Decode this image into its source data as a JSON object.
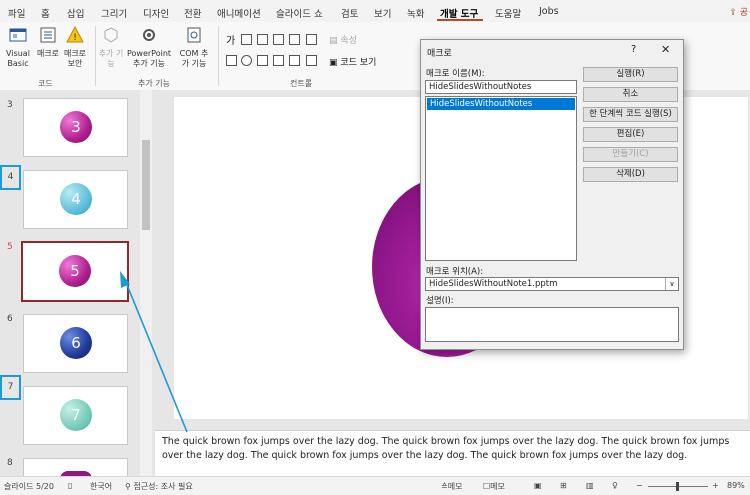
{
  "tabs": [
    "파일",
    "홈",
    "삽입",
    "그리기",
    "디자인",
    "전환",
    "애니메이션",
    "슬라이드 쇼",
    "검토",
    "보기",
    "녹화",
    "개발 도구",
    "도움말",
    "Jobs"
  ],
  "active_tab": "개발 도구",
  "share_label": "공",
  "ribbon": {
    "code": {
      "vb": "Visual Basic",
      "macro": "매크로",
      "security": "매크로 보안",
      "label": "코드"
    },
    "addins": {
      "addin": "추가 기능",
      "ppt_addin": "PowerPoint 추가 기능",
      "com_addin": "COM 추가 기능",
      "label": "추가 기능"
    },
    "controls": {
      "props": "속성",
      "view_code": "코드 보기",
      "label": "컨트롤",
      "text_glyph": "가"
    }
  },
  "slides": [
    {
      "num": "3",
      "value": "3"
    },
    {
      "num": "4",
      "value": "4",
      "hidden_mark": "4"
    },
    {
      "num": "5",
      "value": "5"
    },
    {
      "num": "6",
      "value": "6"
    },
    {
      "num": "7",
      "value": "7",
      "hidden_mark": "7"
    },
    {
      "num": "8",
      "value": ""
    }
  ],
  "notes": "The quick brown fox jumps over the lazy dog. The quick brown fox jumps over the lazy dog. The quick brown fox jumps over the lazy dog. The quick brown fox jumps over the lazy dog. The quick brown fox jumps over the lazy dog.",
  "status": {
    "slide": "슬라이드 5/20",
    "lang": "한국어",
    "access": "접근성: 조사 필요",
    "notes": "슬라이드 노트",
    "notes_btn": "메모",
    "comments_btn": "메모",
    "zoom": "89%",
    "zoom_minus": "−",
    "zoom_plus": "+"
  },
  "dialog": {
    "title": "매크로",
    "help": "?",
    "close": "✕",
    "name_label": "매크로 이름(M):",
    "name_value": "HideSlidesWithoutNotes",
    "list": [
      "HideSlidesWithoutNotes"
    ],
    "location_label": "매크로 위치(A):",
    "location_value": "HideSlidesWithoutNote1.pptm",
    "desc_label": "설명(I):",
    "buttons": {
      "run": "실행(R)",
      "cancel": "취소",
      "step": "한 단계씩 코드 실행(S)",
      "edit": "편집(E)",
      "create": "만들기(C)",
      "delete": "삭제(D)"
    }
  },
  "colors": {
    "accent": "#b7472a",
    "selected_thumb_border": "#8b2a2a",
    "hidden_marker": "#1e9ad6",
    "list_selection": "#0078d7"
  }
}
